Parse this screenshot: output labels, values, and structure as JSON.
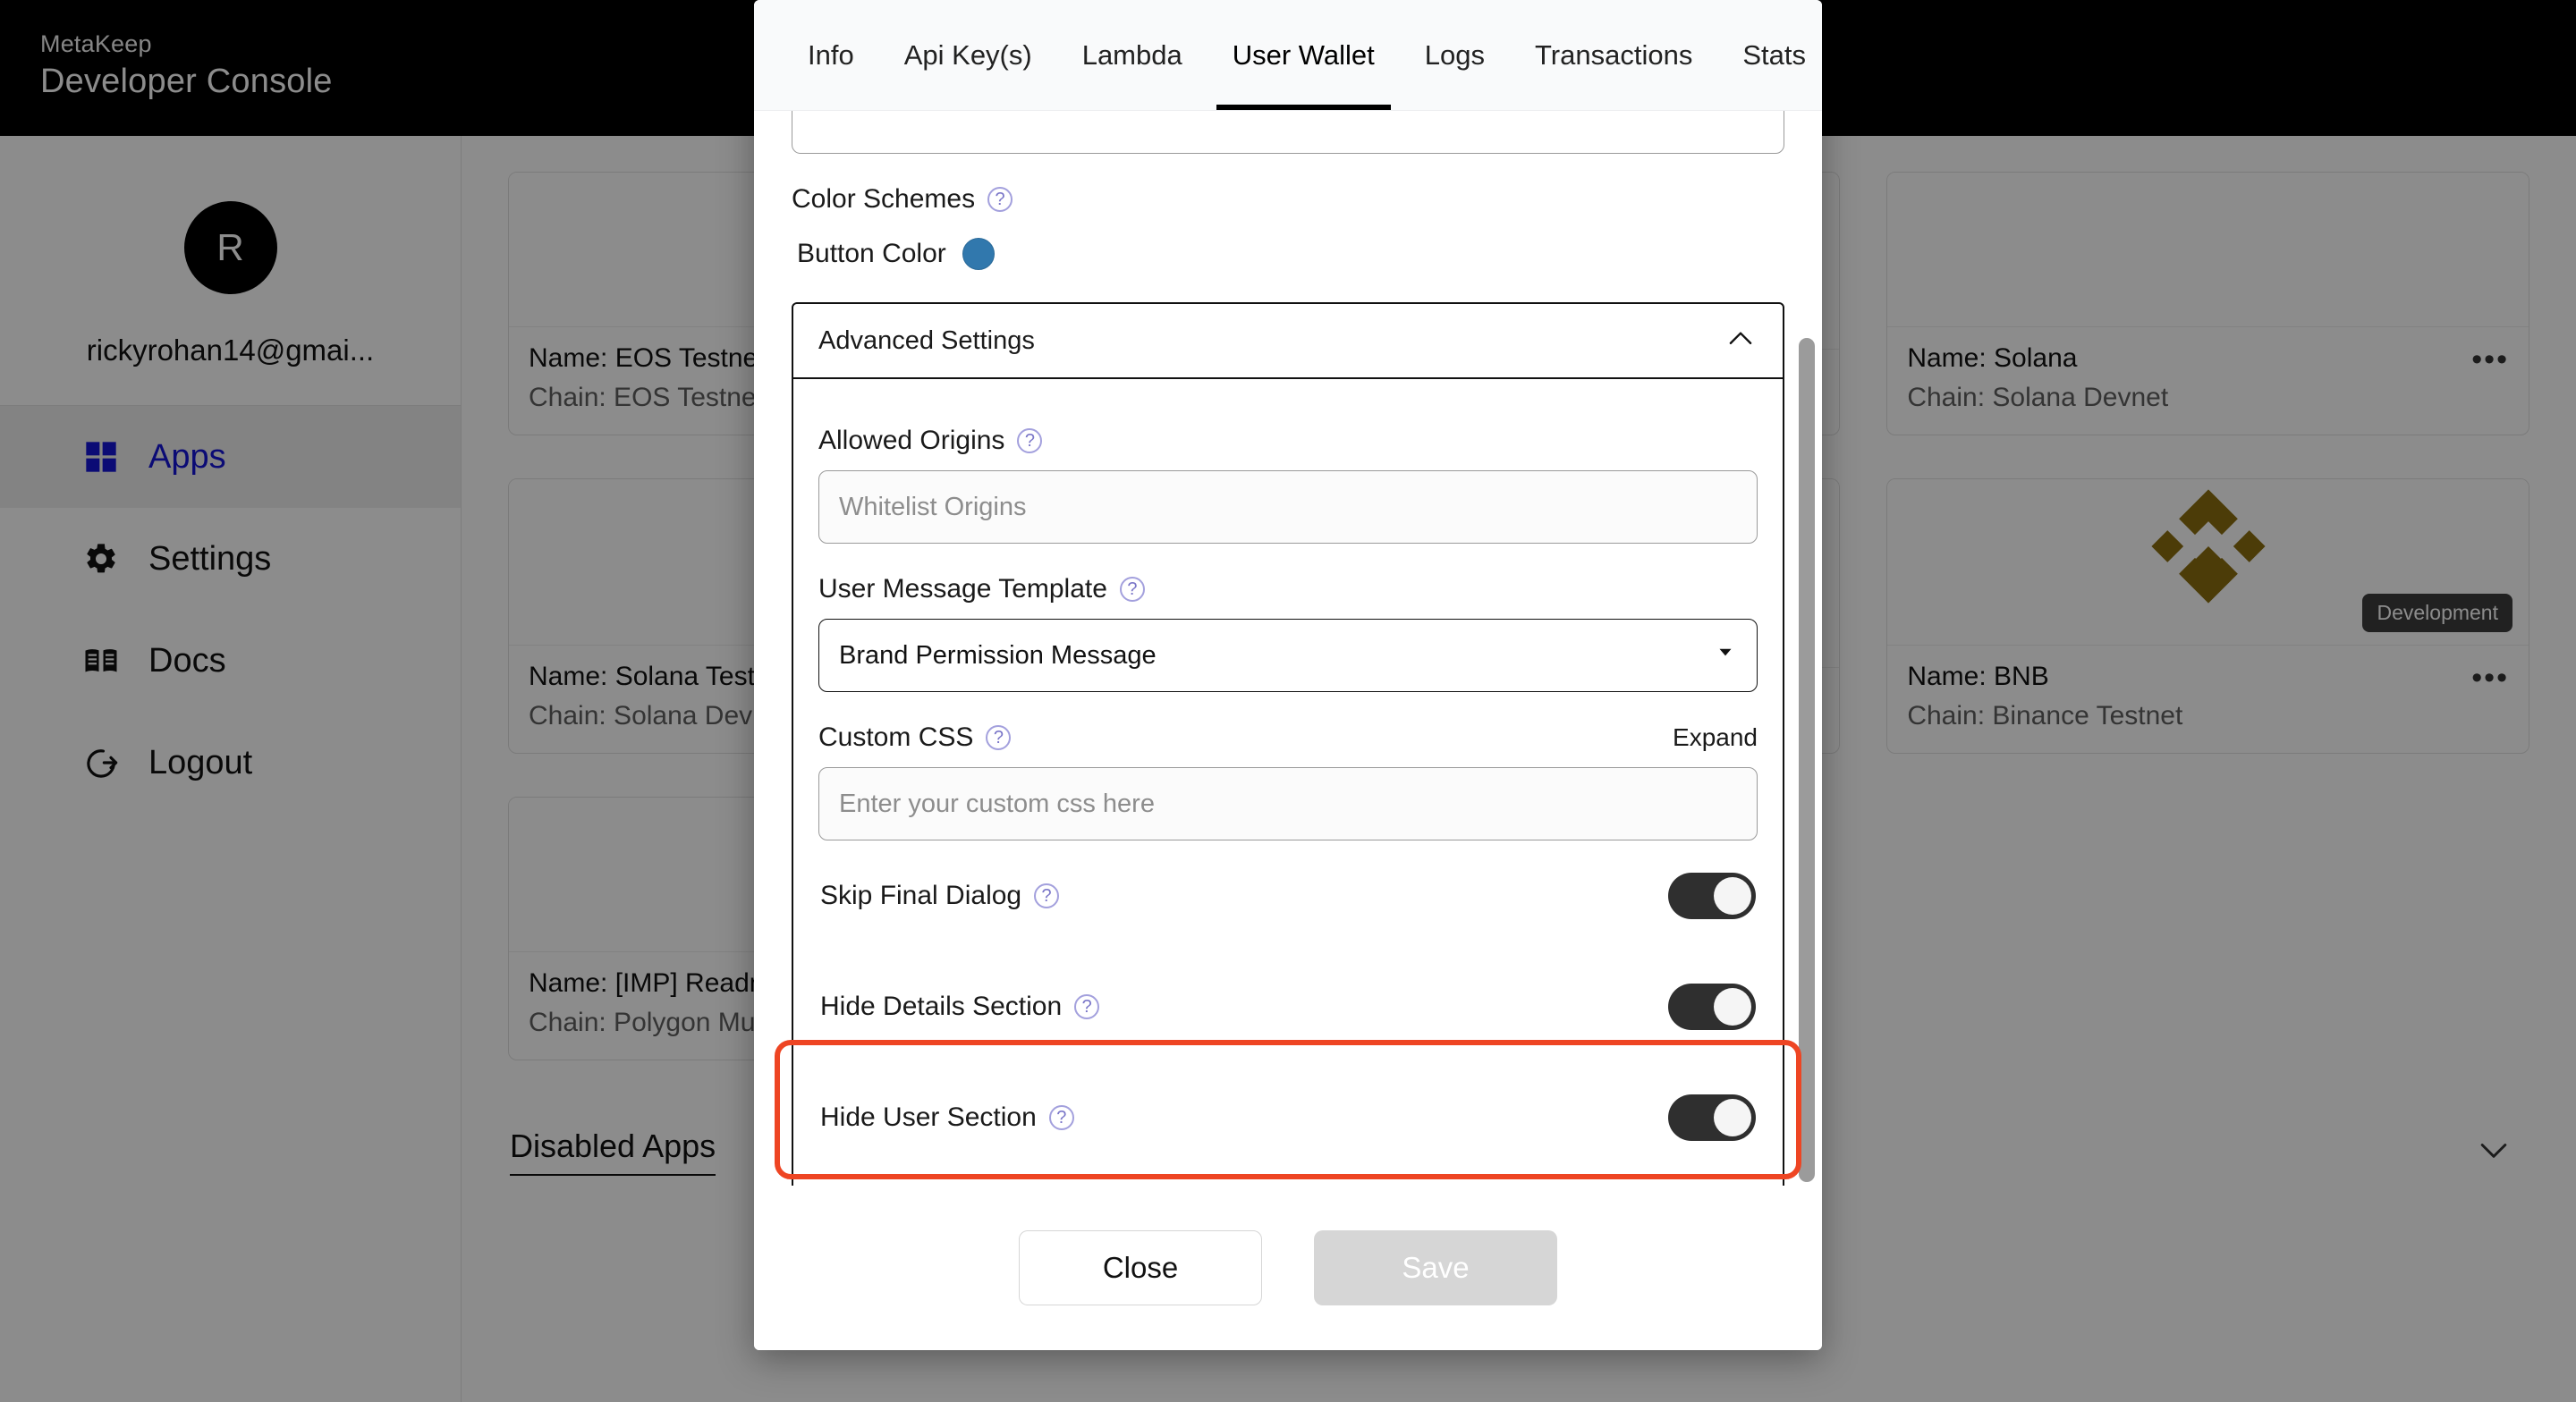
{
  "brand": {
    "name": "MetaKeep",
    "product": "Developer Console"
  },
  "sidebar": {
    "avatar_initial": "R",
    "email": "rickyrohan14@gmai...",
    "items": [
      {
        "label": "Apps",
        "icon": "grid-icon",
        "active": true
      },
      {
        "label": "Settings",
        "icon": "gear-icon",
        "active": false
      },
      {
        "label": "Docs",
        "icon": "book-icon",
        "active": false
      },
      {
        "label": "Logout",
        "icon": "logout-icon",
        "active": false
      }
    ]
  },
  "main": {
    "cards": [
      {
        "name": "Name: EOS Testnet",
        "chain": "Chain: EOS Testnet",
        "logo": "none",
        "badge": ""
      },
      {
        "name": "",
        "chain": "",
        "logo": "none",
        "badge": ""
      },
      {
        "name": "Name: Solana",
        "chain": "Chain: Solana Devnet",
        "logo": "none",
        "badge": ""
      },
      {
        "name": "Name: Solana Testnet",
        "chain": "Chain: Solana Devnet",
        "logo": "none",
        "badge": ""
      },
      {
        "name": "",
        "chain": "",
        "logo": "none",
        "badge": ""
      },
      {
        "name": "Name: BNB",
        "chain": "Chain: Binance Testnet",
        "logo": "binance-logo",
        "badge": "Development"
      },
      {
        "name": "Name: [IMP] Readme",
        "chain": "Chain: Polygon Mumbai",
        "logo": "none",
        "badge": ""
      }
    ],
    "kebab_glyph": "•••",
    "disabled_apps": {
      "title": "Disabled Apps",
      "chevron": "chevron-down-icon"
    }
  },
  "modal": {
    "tabs": [
      {
        "label": "Info",
        "active": false
      },
      {
        "label": "Api Key(s)",
        "active": false
      },
      {
        "label": "Lambda",
        "active": false
      },
      {
        "label": "User Wallet",
        "active": true
      },
      {
        "label": "Logs",
        "active": false
      },
      {
        "label": "Transactions",
        "active": false
      },
      {
        "label": "Stats",
        "active": false
      }
    ],
    "color_schemes": {
      "label": "Color Schemes",
      "help": "?",
      "button_color_label": "Button Color",
      "button_color_value": "#3178ad"
    },
    "advanced_settings": {
      "title": "Advanced Settings",
      "collapse_icon": "chevron-up-icon",
      "allowed_origins": {
        "label": "Allowed Origins",
        "help": "?",
        "value": "",
        "placeholder": "Whitelist Origins"
      },
      "user_message_template": {
        "label": "User Message Template",
        "help": "?",
        "selected": "Brand Permission Message",
        "chevron": "chevron-down-icon"
      },
      "custom_css": {
        "label": "Custom CSS",
        "help": "?",
        "expand_label": "Expand",
        "value": "",
        "placeholder": "Enter your custom css here"
      },
      "toggles": [
        {
          "label": "Skip Final Dialog",
          "help": "?",
          "on": true,
          "highlighted": false
        },
        {
          "label": "Hide Details Section",
          "help": "?",
          "on": true,
          "highlighted": false
        },
        {
          "label": "Hide User Section",
          "help": "?",
          "on": true,
          "highlighted": true
        }
      ]
    },
    "footer": {
      "close_label": "Close",
      "save_label": "Save",
      "save_disabled": true
    }
  },
  "annotation": {
    "highlight_color": "#ee4523",
    "target": "Hide User Section"
  }
}
